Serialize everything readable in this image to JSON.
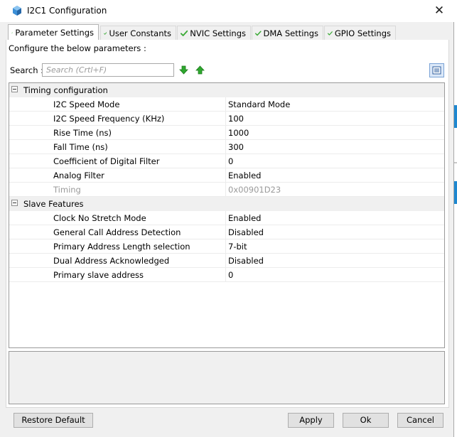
{
  "window": {
    "title": "I2C1 Configuration",
    "close_glyph": "✕",
    "app_icon": "cube-icon"
  },
  "tabs": [
    {
      "label": "Parameter Settings",
      "active": true,
      "icon": "check-icon"
    },
    {
      "label": "User Constants",
      "active": false,
      "icon": "check-icon"
    },
    {
      "label": "NVIC Settings",
      "active": false,
      "icon": "check-icon"
    },
    {
      "label": "DMA Settings",
      "active": false,
      "icon": "check-icon"
    },
    {
      "label": "GPIO Settings",
      "active": false,
      "icon": "check-icon"
    }
  ],
  "panel": {
    "hint": "Configure the below parameters :",
    "search_label": "Search :",
    "search_placeholder": "Search (Crtl+F)"
  },
  "groups": [
    {
      "title": "Timing configuration",
      "rows": [
        {
          "name": "I2C Speed Mode",
          "value": "Standard Mode",
          "enabled": true
        },
        {
          "name": "I2C Speed Frequency (KHz)",
          "value": "100",
          "enabled": true
        },
        {
          "name": "Rise Time (ns)",
          "value": "1000",
          "enabled": true
        },
        {
          "name": "Fall Time (ns)",
          "value": "300",
          "enabled": true
        },
        {
          "name": "Coefficient of Digital Filter",
          "value": "0",
          "enabled": true
        },
        {
          "name": "Analog Filter",
          "value": "Enabled",
          "enabled": true
        },
        {
          "name": "Timing",
          "value": "0x00901D23",
          "enabled": false
        }
      ]
    },
    {
      "title": "Slave Features",
      "rows": [
        {
          "name": "Clock No Stretch Mode",
          "value": "Enabled",
          "enabled": true
        },
        {
          "name": "General Call Address Detection",
          "value": "Disabled",
          "enabled": true
        },
        {
          "name": "Primary Address Length selection",
          "value": "7-bit",
          "enabled": true
        },
        {
          "name": "Dual Address Acknowledged",
          "value": "Disabled",
          "enabled": true
        },
        {
          "name": "Primary slave address",
          "value": "0",
          "enabled": true
        }
      ]
    }
  ],
  "buttons": {
    "restore": "Restore Default",
    "apply": "Apply",
    "ok": "Ok",
    "cancel": "Cancel"
  },
  "colors": {
    "check_green": "#3aaa35",
    "arrow_green": "#2ea82e",
    "accent_blue": "#1e88d0"
  }
}
